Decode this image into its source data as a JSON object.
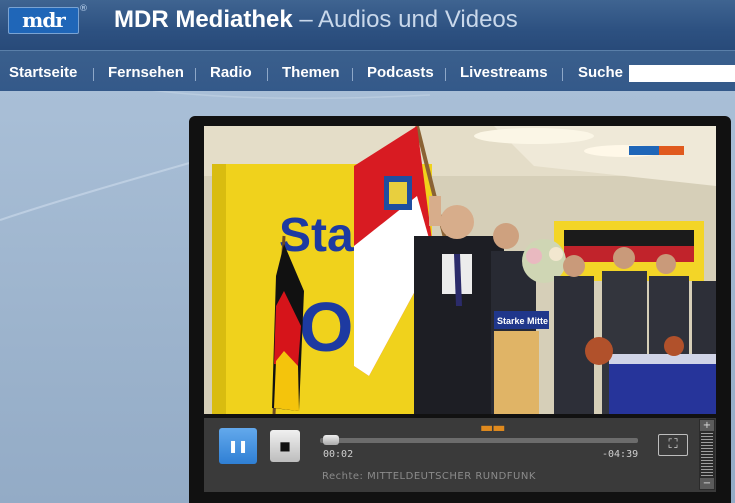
{
  "header": {
    "logo_text": "mdr",
    "logo_reg": "®",
    "title_bold": "MDR Mediathek",
    "title_rest": "– Audios und Videos"
  },
  "nav": {
    "items": [
      "Startseite",
      "Fernsehen",
      "Radio",
      "Themen",
      "Podcasts",
      "Livestreams"
    ],
    "search_label": "Suche",
    "search_value": ""
  },
  "player": {
    "elapsed": "00:02",
    "remaining": "-04:39",
    "rights": "Rechte: MITTELDEUTSCHER RUNDFUNK",
    "progress": 0.01,
    "state": "playing",
    "video_overlay_sign": "Stat",
    "video_overlay_sign2": "O",
    "video_overlay_small": "Starke Mitte"
  },
  "colors": {
    "header_bg": "#2d5181",
    "nav_bg": "#3a5f8c",
    "page_bg": "#9fb6cf",
    "accent_blue": "#2f7fd4",
    "progress_accent": "#e08a1e"
  },
  "icons": {
    "pause": "pause-icon",
    "stop": "stop-icon",
    "fullscreen": "fullscreen-icon",
    "volume_plus": "plus-icon",
    "volume_minus": "minus-icon"
  }
}
